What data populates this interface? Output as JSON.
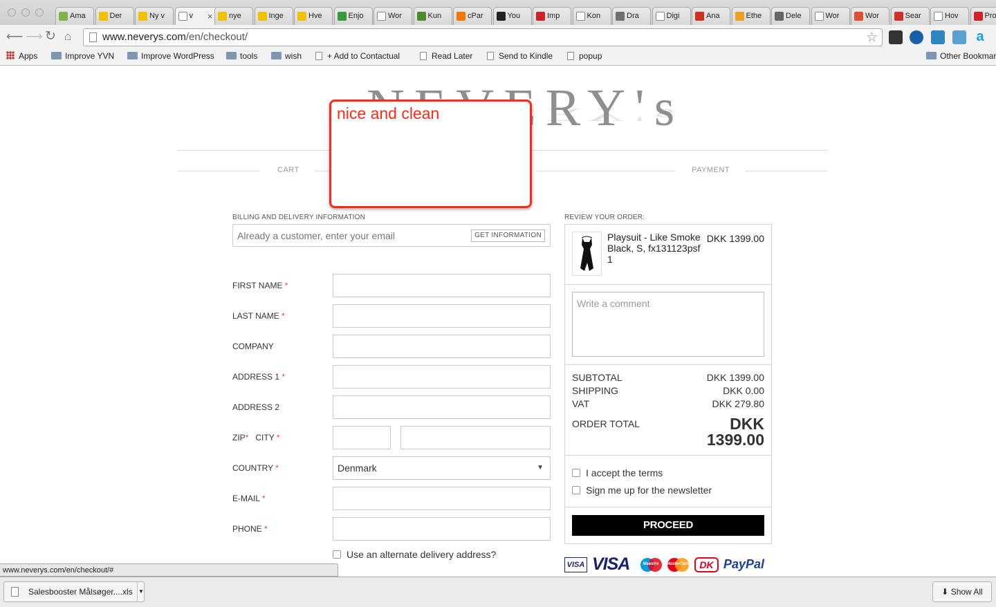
{
  "browser": {
    "tabs": [
      {
        "label": "Ama",
        "icon": "cloud-icon",
        "color": "#7fb24a"
      },
      {
        "label": "Der",
        "icon": "bulb-icon",
        "color": "#f2c200"
      },
      {
        "label": "Ny v",
        "icon": "bulb-icon",
        "color": "#f2c200"
      },
      {
        "label": "v",
        "icon": "page-icon",
        "color": "#ffffff"
      },
      {
        "label": "nye",
        "icon": "bulb-icon",
        "color": "#f2c200"
      },
      {
        "label": "Inge",
        "icon": "bulb-icon",
        "color": "#f2c200"
      },
      {
        "label": "Hve",
        "icon": "bulb-icon",
        "color": "#f2c200"
      },
      {
        "label": "Enjo",
        "icon": "leaf-icon",
        "color": "#3a9a3a"
      },
      {
        "label": "Wor",
        "icon": "page-icon",
        "color": "#ffffff"
      },
      {
        "label": "Kun",
        "icon": "clover-icon",
        "color": "#4a8a2a"
      },
      {
        "label": "cPar",
        "icon": "cpanel-icon",
        "color": "#f07a00"
      },
      {
        "label": "You",
        "icon": "g-icon",
        "color": "#222222"
      },
      {
        "label": "Imp",
        "icon": "plus-icon",
        "color": "#d0202a"
      },
      {
        "label": "Kon",
        "icon": "page-icon",
        "color": "#ffffff"
      },
      {
        "label": "Dra",
        "icon": "square-icon",
        "color": "#707070"
      },
      {
        "label": "Digi",
        "icon": "page-icon",
        "color": "#ffffff"
      },
      {
        "label": "Ana",
        "icon": "triangle-icon",
        "color": "#d03020"
      },
      {
        "label": "Ethe",
        "icon": "key-icon",
        "color": "#f0a020"
      },
      {
        "label": "Dele",
        "icon": "pin-icon",
        "color": "#666666"
      },
      {
        "label": "Wor",
        "icon": "page-icon",
        "color": "#ffffff"
      },
      {
        "label": "Wor",
        "icon": "g-icon",
        "color": "#e05030"
      },
      {
        "label": "Sear",
        "icon": "gmail-icon",
        "color": "#d0302a"
      },
      {
        "label": "Hov",
        "icon": "page-icon",
        "color": "#ffffff"
      },
      {
        "label": "Pron",
        "icon": "w-icon",
        "color": "#d0202a"
      }
    ],
    "url_host": "www.neverys.com",
    "url_path": "/en/checkout/",
    "bookmarks": [
      {
        "label": "Apps",
        "type": "apps"
      },
      {
        "label": "Improve YVN",
        "type": "folder"
      },
      {
        "label": "Improve WordPress",
        "type": "folder"
      },
      {
        "label": "tools",
        "type": "folder"
      },
      {
        "label": "wish",
        "type": "folder"
      },
      {
        "label": "+ Add to Contactual",
        "type": "page"
      },
      {
        "label": "Read Later",
        "type": "page"
      },
      {
        "label": "Send to Kindle",
        "type": "page"
      },
      {
        "label": "popup",
        "type": "page"
      }
    ],
    "other_bookmarks": "Other Bookmarks",
    "status_url": "www.neverys.com/en/checkout/#",
    "download_name": "Salesbooster Målsøger....xls",
    "show_all": "Show All",
    "colors": {
      "ext_1": "#333333",
      "ext_2": "#1a5fa8",
      "ext_3": "#2e86c1",
      "ext_4": "#5aa0d0",
      "ext_5": "#18a0e0"
    }
  },
  "site": {
    "logo": "NEVERY's",
    "annotation": "nice and clean",
    "steps": {
      "cart": "CART",
      "payment": "PAYMENT"
    },
    "billing": {
      "title": "BILLING AND DELIVERY INFORMATION",
      "customer_placeholder": "Already a customer, enter your email",
      "get_info": "GET INFORMATION",
      "first_name": "FIRST NAME",
      "last_name": "LAST NAME",
      "company": "COMPANY",
      "address1": "ADDRESS 1",
      "address2": "ADDRESS 2",
      "zip": "ZIP",
      "city": "CITY",
      "country": "COUNTRY",
      "country_value": "Denmark",
      "email": "E-MAIL",
      "phone": "PHONE",
      "required_mark": "*",
      "alt_delivery": "Use an alternate delivery address?"
    },
    "review": {
      "title": "REVIEW YOUR ORDER:",
      "product_name": "Playsuit - Like Smoke",
      "product_variant": "Black, S, fx131123psf",
      "product_qty": "1",
      "product_price": "DKK 1399.00",
      "comment_placeholder": "Write a comment",
      "subtotal_label": "SUBTOTAL",
      "subtotal": "DKK 1399.00",
      "shipping_label": "SHIPPING",
      "shipping": "DKK 0.00",
      "vat_label": "VAT",
      "vat": "DKK 279.80",
      "total_label": "ORDER TOTAL",
      "total_currency": "DKK",
      "total_amount": "1399.00",
      "terms": "I accept the terms",
      "newsletter": "Sign me up for the newsletter",
      "proceed": "PROCEED"
    },
    "payments": {
      "visa_electron": "VISA",
      "visa": "VISA",
      "maestro": "Maestro",
      "mastercard": "MasterCard",
      "dankort": "DK",
      "paypal": "PayPal"
    },
    "colors": {
      "annotation": "#ff2a1a",
      "required": "#e04545",
      "proceed_bg": "#000000",
      "visa_blue": "#1a1f71",
      "paypal_blue": "#1c3f94",
      "paypal_light": "#009cde",
      "master_red": "#eb001b",
      "master_orange": "#f79e1b",
      "dankort_red": "#e3001b"
    }
  }
}
